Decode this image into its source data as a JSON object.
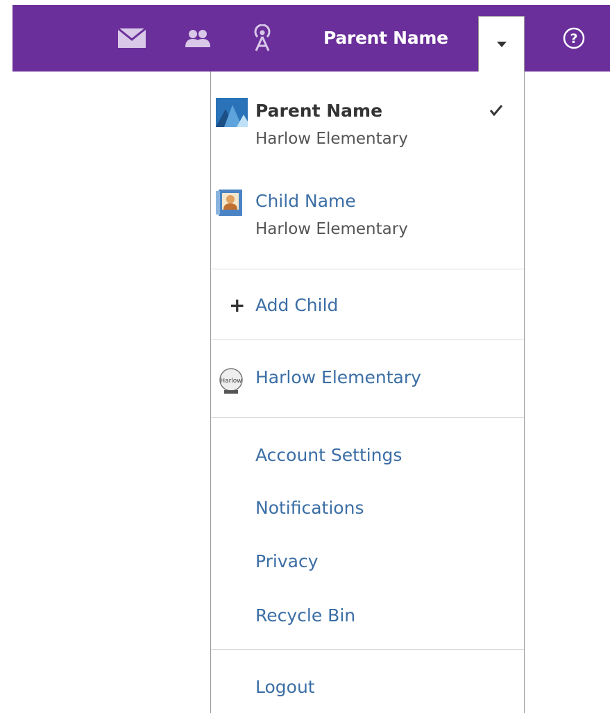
{
  "header": {
    "user_name": "Parent Name",
    "icons": {
      "mail": "mail-icon",
      "people": "people-icon",
      "feed": "feed-icon",
      "dropdown": "caret-down-icon",
      "help": "help-icon"
    },
    "brand_color": "#6a2f9a"
  },
  "menu": {
    "accounts": [
      {
        "name": "Parent Name",
        "school": "Harlow Elementary",
        "selected": true
      },
      {
        "name": "Child Name",
        "school": "Harlow Elementary",
        "selected": false
      }
    ],
    "add_child_label": "Add Child",
    "school_label": "Harlow Elementary",
    "school_logo_text": "Harlow",
    "items": [
      {
        "label": "Account Settings"
      },
      {
        "label": "Notifications"
      },
      {
        "label": "Privacy"
      },
      {
        "label": "Recycle Bin"
      }
    ],
    "logout_label": "Logout",
    "link_color": "#3b6ea5"
  }
}
